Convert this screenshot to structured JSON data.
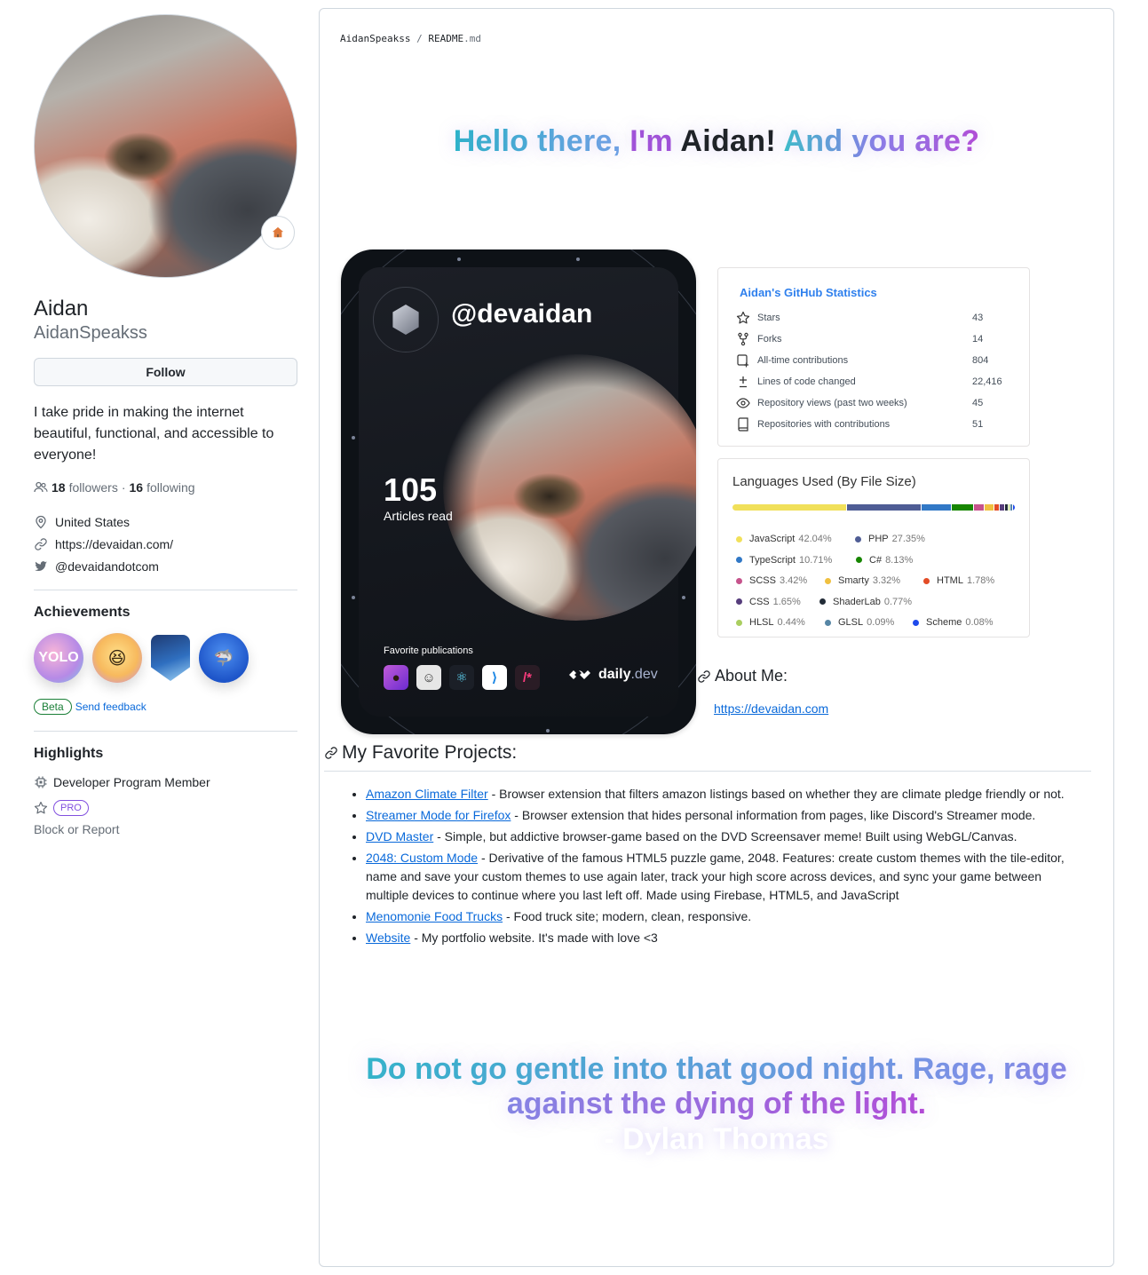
{
  "profile": {
    "name": "Aidan",
    "login": "AidanSpeakss",
    "follow_label": "Follow",
    "bio": "I take pride in making the internet beautiful, functional, and accessible to everyone!",
    "followers_count": "18",
    "followers_label": "followers",
    "following_count": "16",
    "following_label": "following",
    "separator": "·",
    "location": "United States",
    "website": "https://devaidan.com/",
    "twitter": "@devaidandotcom",
    "status_emoji_icon": "house-icon"
  },
  "achievements": {
    "title": "Achievements",
    "items": [
      {
        "name": "yolo",
        "label": "YOLO"
      },
      {
        "name": "quickdraw",
        "label": "😆"
      },
      {
        "name": "arctic-code-vault",
        "label": ""
      },
      {
        "name": "pull-shark",
        "label": "🦈"
      }
    ],
    "beta_label": "Beta",
    "feedback_label": "Send feedback"
  },
  "highlights": {
    "title": "Highlights",
    "developer_program": "Developer Program Member",
    "pro_label": "PRO",
    "block_report": "Block or Report"
  },
  "readme": {
    "crumb_user": "AidanSpeakss",
    "crumb_sep": "/",
    "crumb_file": "README",
    "crumb_ext": ".md",
    "hello": {
      "part1": "Hello there,",
      "part2": "I'm",
      "part3": "Aidan!",
      "part4": "And you are?"
    }
  },
  "devcard": {
    "handle": "@devaidan",
    "articles_count": "105",
    "articles_label": "Articles read",
    "favorites_label": "Favorite publications",
    "brand_main": "daily",
    "brand_suffix": ".dev"
  },
  "github_stats": {
    "title": "Aidan's GitHub Statistics",
    "rows": [
      {
        "label": "Stars",
        "value": "43",
        "icon": "star-icon"
      },
      {
        "label": "Forks",
        "value": "14",
        "icon": "fork-icon"
      },
      {
        "label": "All-time contributions",
        "value": "804",
        "icon": "contribution-icon"
      },
      {
        "label": "Lines of code changed",
        "value": "22,416",
        "icon": "diff-icon"
      },
      {
        "label": "Repository views (past two weeks)",
        "value": "45",
        "icon": "eye-icon"
      },
      {
        "label": "Repositories with contributions",
        "value": "51",
        "icon": "repo-icon"
      }
    ]
  },
  "languages": {
    "title": "Languages Used (By File Size)",
    "items": [
      {
        "name": "JavaScript",
        "pct": "42.04%",
        "value": 42.04,
        "color": "#f1e05a"
      },
      {
        "name": "PHP",
        "pct": "27.35%",
        "value": 27.35,
        "color": "#4f5d95"
      },
      {
        "name": "TypeScript",
        "pct": "10.71%",
        "value": 10.71,
        "color": "#3178c6"
      },
      {
        "name": "C#",
        "pct": "8.13%",
        "value": 8.13,
        "color": "#178600"
      },
      {
        "name": "SCSS",
        "pct": "3.42%",
        "value": 3.42,
        "color": "#c6538c"
      },
      {
        "name": "Smarty",
        "pct": "3.32%",
        "value": 3.32,
        "color": "#f0c040"
      },
      {
        "name": "HTML",
        "pct": "1.78%",
        "value": 1.78,
        "color": "#e34c26"
      },
      {
        "name": "CSS",
        "pct": "1.65%",
        "value": 1.65,
        "color": "#563d7c"
      },
      {
        "name": "ShaderLab",
        "pct": "0.77%",
        "value": 0.77,
        "color": "#222c37"
      },
      {
        "name": "HLSL",
        "pct": "0.44%",
        "value": 0.44,
        "color": "#aace60"
      },
      {
        "name": "GLSL",
        "pct": "0.09%",
        "value": 0.09,
        "color": "#5686a5"
      },
      {
        "name": "Scheme",
        "pct": "0.08%",
        "value": 0.08,
        "color": "#1e4aec"
      }
    ]
  },
  "about": {
    "heading": "About Me:",
    "link": "https://devaidan.com"
  },
  "projects": {
    "heading": "My Favorite Projects:",
    "items": [
      {
        "title": "Amazon Climate Filter",
        "desc": " - Browser extension that filters amazon listings based on whether they are climate pledge friendly or not."
      },
      {
        "title": "Streamer Mode for Firefox",
        "desc": " - Browser extension that hides personal information from pages, like Discord's Streamer mode."
      },
      {
        "title": "DVD Master",
        "desc": " - Simple, but addictive browser-game based on the DVD Screensaver meme! Built using WebGL/Canvas."
      },
      {
        "title": "2048: Custom Mode",
        "desc": " - Derivative of the famous HTML5 puzzle game, 2048. Features: create custom themes with the tile-editor, name and save your custom themes to use again later, track your high score across devices, and sync your game between multiple devices to continue where you last left off. Made using Firebase, HTML5, and JavaScript"
      },
      {
        "title": "Menomonie Food Trucks",
        "desc": " - Food truck site; modern, clean, responsive."
      },
      {
        "title": "Website",
        "desc": " - My portfolio website. It's made with love <3"
      }
    ]
  },
  "quote": {
    "text": "Do not go gentle into that good night. Rage, rage against the dying of the light.",
    "author": "- Dylan Thomas"
  }
}
